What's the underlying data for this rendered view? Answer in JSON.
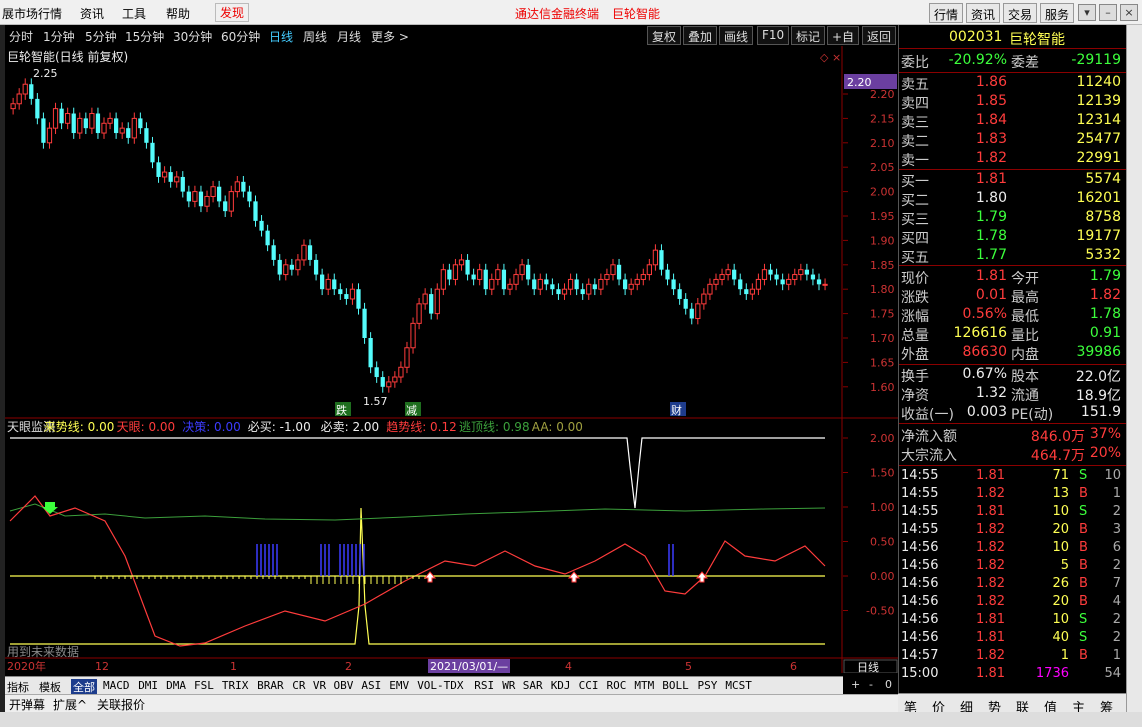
{
  "menubar": {
    "items": [
      "展市场行情",
      "资讯",
      "工具",
      "帮助",
      "发现"
    ],
    "center_title": "通达信金融终端",
    "center_stock": "巨轮智能",
    "right_buttons": [
      "行情",
      "资讯",
      "交易",
      "服务"
    ]
  },
  "toolbar": {
    "periods": [
      "分时",
      "1分钟",
      "5分钟",
      "15分钟",
      "30分钟",
      "60分钟",
      "日线",
      "周线",
      "月线",
      "更多 >"
    ],
    "active_period": "日线",
    "right_buttons": [
      "复权",
      "叠加",
      "画线",
      "F10",
      "标记",
      "+自选",
      "返回"
    ]
  },
  "chart": {
    "title": "巨轮智能(日线 前复权)",
    "high_label": "2.25",
    "low_label": "1.57",
    "current_price_box": "2.20",
    "price_axis": [
      "2.20",
      "2.15",
      "2.10",
      "2.05",
      "2.00",
      "1.95",
      "1.90",
      "1.85",
      "1.80",
      "1.75",
      "1.70",
      "1.65",
      "1.60"
    ],
    "markers": [
      "跌",
      "减",
      "财"
    ],
    "indicator_header": [
      {
        "text": "天眼监测",
        "color": "#dddddd"
      },
      {
        "text": "来势线: 0.00",
        "color": "#ffff54"
      },
      {
        "text": "天眼: 0.00",
        "color": "#ff3c3c"
      },
      {
        "text": "决策: 0.00",
        "color": "#3c3cff"
      },
      {
        "text": "必买: -1.00",
        "color": "#eeeeee"
      },
      {
        "text": "必卖: 2.00",
        "color": "#eeeeee"
      },
      {
        "text": "趋势线: 0.12",
        "color": "#ff3c3c"
      },
      {
        "text": "逃顶线: 0.98",
        "color": "#3ca03c"
      },
      {
        "text": "AA: 0.00",
        "color": "#a0a040"
      }
    ],
    "indicator_axis": [
      "2.00",
      "1.50",
      "1.00",
      "0.50",
      "0.00",
      "-0.50"
    ],
    "future_data_note": "用到未来数据",
    "date_axis": [
      "2020年",
      "12",
      "1",
      "2",
      "2021/03/01/—",
      "4",
      "5",
      "6"
    ],
    "period_label": "日线"
  },
  "quote": {
    "code": "002031",
    "name": "巨轮智能",
    "weibi_label": "委比",
    "weibi": "-20.92%",
    "weicha_label": "委差",
    "weicha": "-29119",
    "asks": [
      {
        "label": "卖五",
        "price": "1.86",
        "vol": "11240"
      },
      {
        "label": "卖四",
        "price": "1.85",
        "vol": "12139"
      },
      {
        "label": "卖三",
        "price": "1.84",
        "vol": "12314"
      },
      {
        "label": "卖二",
        "price": "1.83",
        "vol": "25477"
      },
      {
        "label": "卖一",
        "price": "1.82",
        "vol": "22991"
      }
    ],
    "bids": [
      {
        "label": "买一",
        "price": "1.81",
        "vol": "5574"
      },
      {
        "label": "买二",
        "price": "1.80",
        "vol": "16201"
      },
      {
        "label": "买三",
        "price": "1.79",
        "vol": "8758"
      },
      {
        "label": "买四",
        "price": "1.78",
        "vol": "19177"
      },
      {
        "label": "买五",
        "price": "1.77",
        "vol": "5332"
      }
    ],
    "stats": [
      {
        "l1": "现价",
        "v1": "1.81",
        "c1": "up",
        "l2": "今开",
        "v2": "1.79",
        "c2": "dn"
      },
      {
        "l1": "涨跌",
        "v1": "0.01",
        "c1": "up",
        "l2": "最高",
        "v2": "1.82",
        "c2": "up"
      },
      {
        "l1": "涨幅",
        "v1": "0.56%",
        "c1": "up",
        "l2": "最低",
        "v2": "1.78",
        "c2": "dn"
      },
      {
        "l1": "总量",
        "v1": "126616",
        "c1": "yl",
        "l2": "量比",
        "v2": "0.91",
        "c2": "dn"
      },
      {
        "l1": "外盘",
        "v1": "86630",
        "c1": "up",
        "l2": "内盘",
        "v2": "39986",
        "c2": "dn"
      }
    ],
    "stats2": [
      {
        "l1": "换手",
        "v1": "0.67%",
        "l2": "股本",
        "v2": "22.0亿"
      },
      {
        "l1": "净资",
        "v1": "1.32",
        "l2": "流通",
        "v2": "18.9亿"
      },
      {
        "l1": "收益(一)",
        "v1": "0.003",
        "l2": "PE(动)",
        "v2": "151.9"
      }
    ],
    "flows": [
      {
        "label": "净流入额",
        "value": "846.0万",
        "pct": "37%"
      },
      {
        "label": "大宗流入",
        "value": "464.7万",
        "pct": "20%"
      }
    ],
    "trades": [
      {
        "t": "14:55",
        "p": "1.81",
        "v": "71",
        "s": "S",
        "n": "10"
      },
      {
        "t": "14:55",
        "p": "1.82",
        "v": "13",
        "s": "B",
        "n": "1"
      },
      {
        "t": "14:55",
        "p": "1.81",
        "v": "10",
        "s": "S",
        "n": "2"
      },
      {
        "t": "14:55",
        "p": "1.82",
        "v": "20",
        "s": "B",
        "n": "3"
      },
      {
        "t": "14:56",
        "p": "1.82",
        "v": "10",
        "s": "B",
        "n": "6"
      },
      {
        "t": "14:56",
        "p": "1.82",
        "v": "5",
        "s": "B",
        "n": "2"
      },
      {
        "t": "14:56",
        "p": "1.82",
        "v": "26",
        "s": "B",
        "n": "7"
      },
      {
        "t": "14:56",
        "p": "1.82",
        "v": "20",
        "s": "B",
        "n": "4"
      },
      {
        "t": "14:56",
        "p": "1.81",
        "v": "10",
        "s": "S",
        "n": "2"
      },
      {
        "t": "14:56",
        "p": "1.81",
        "v": "40",
        "s": "S",
        "n": "2"
      },
      {
        "t": "14:57",
        "p": "1.82",
        "v": "1",
        "s": "B",
        "n": "1"
      },
      {
        "t": "15:00",
        "p": "1.81",
        "v": "1736",
        "s": "",
        "n": "54"
      }
    ],
    "bottom_tabs": [
      "笔",
      "价",
      "细",
      "势",
      "联",
      "值",
      "主",
      "筹"
    ]
  },
  "indicator_tabs": [
    "指标",
    "模板",
    "全部",
    "MACD",
    "DMI",
    "DMA",
    "FSL",
    "TRIX",
    "BRAR",
    "CR",
    "VR",
    "OBV",
    "ASI",
    "EMV",
    "VOL-TDX",
    "RSI",
    "WR",
    "SAR",
    "KDJ",
    "CCI",
    "ROC",
    "MTM",
    "BOLL",
    "PSY",
    "MCST"
  ],
  "indicator_tabs_active": "全部",
  "indicator_right": [
    "+",
    "-",
    "0"
  ],
  "ext_tabs": [
    "开弹幕",
    "扩展^",
    "关联报价"
  ]
}
